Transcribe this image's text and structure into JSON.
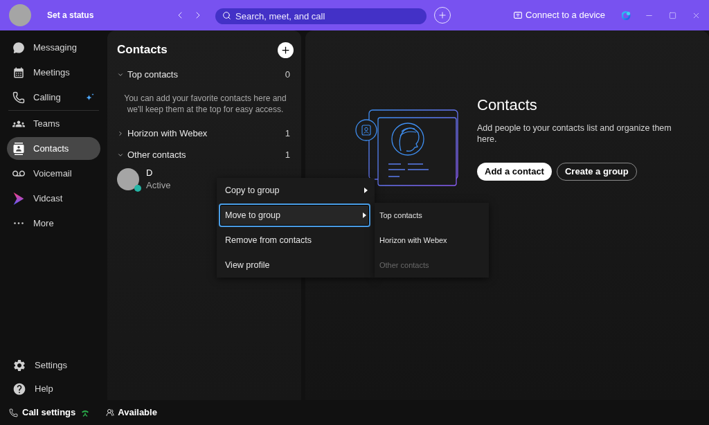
{
  "title_bar": {
    "status": "Set a status",
    "search": {
      "placeholder": "Search, meet, and call"
    },
    "connect": "Connect to a device"
  },
  "sidebar": {
    "sections": [
      {
        "items": [
          {
            "label": "Messaging",
            "selected": false,
            "sparkle": false
          },
          {
            "label": "Meetings",
            "selected": false,
            "sparkle": false
          },
          {
            "label": "Calling",
            "selected": false,
            "sparkle": true
          }
        ]
      },
      {
        "items": [
          {
            "label": "Teams",
            "selected": false,
            "sparkle": false
          },
          {
            "label": "Contacts",
            "selected": true,
            "sparkle": false
          },
          {
            "label": "Voicemail",
            "selected": false,
            "sparkle": false
          },
          {
            "label": "Vidcast",
            "selected": false,
            "sparkle": false
          },
          {
            "label": "More",
            "selected": false,
            "sparkle": false
          }
        ]
      }
    ],
    "bottom_items": [
      {
        "label": "Settings"
      },
      {
        "label": "Help"
      }
    ]
  },
  "contacts_panel": {
    "title": "Contacts",
    "groups": [
      {
        "name": "Top contacts",
        "count": "0",
        "expanded": true,
        "empty_message": "You can add your favorite contacts here and we'll keep them at the top for easy access."
      },
      {
        "name": "Horizon with Webex",
        "count": "1",
        "expanded": false
      },
      {
        "name": "Other contacts",
        "count": "1",
        "expanded": true,
        "contacts": [
          {
            "name": "D",
            "status": "Active",
            "color": "#24b5a5"
          }
        ]
      }
    ]
  },
  "main": {
    "title": "Contacts",
    "description": "Add people to your contacts list and organize them here.",
    "buttons": [
      {
        "label": "Add a contact",
        "kind": "primary"
      },
      {
        "label": "Create a group",
        "kind": "secondary"
      }
    ]
  },
  "context_menu": {
    "items": [
      {
        "label": "Copy to group",
        "has_submenu": true,
        "selected": false
      },
      {
        "label": "Move to group",
        "has_submenu": true,
        "selected": true
      },
      {
        "label": "Remove from contacts",
        "has_submenu": false,
        "selected": false
      },
      {
        "label": "View profile",
        "has_submenu": false,
        "selected": false
      }
    ]
  },
  "submenu": {
    "items": [
      {
        "label": "Top contacts",
        "disabled": false
      },
      {
        "label": "Horizon with Webex",
        "disabled": false
      },
      {
        "label": "Other contacts",
        "disabled": true
      }
    ]
  },
  "footer": {
    "call_settings": "Call settings",
    "availability": "Available"
  }
}
